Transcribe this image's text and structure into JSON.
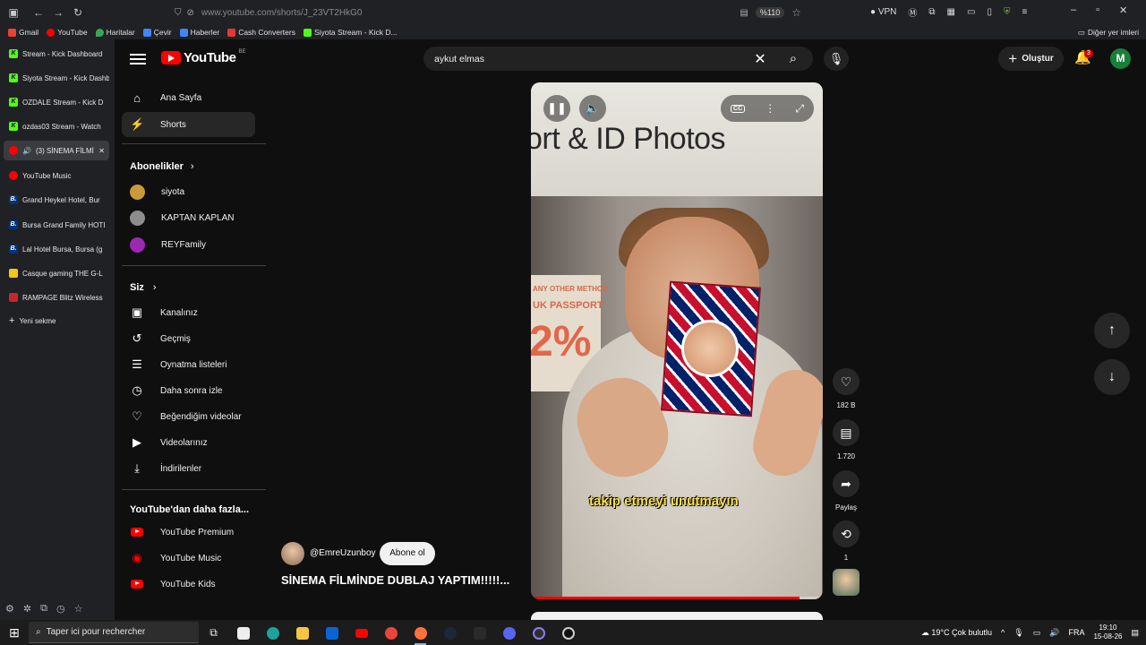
{
  "browser": {
    "url": "www.youtube.com/shorts/J_23VT2HkG0",
    "zoom": "%110",
    "vpn_label": "VPN",
    "bookmarks": [
      {
        "label": "Gmail",
        "color": "#ea4335"
      },
      {
        "label": "YouTube",
        "color": "#ff0000"
      },
      {
        "label": "Haritalar",
        "color": "#34a853"
      },
      {
        "label": "Çevir",
        "color": "#4285f4"
      },
      {
        "label": "Haberler",
        "color": "#4285f4"
      },
      {
        "label": "Cash Converters",
        "color": "#e53935"
      },
      {
        "label": "Siyota Stream - Kick D...",
        "color": "#53fc18"
      }
    ],
    "other_bookmarks": "Diğer yer imleri",
    "tabs": [
      {
        "label": "Stream - Kick Dashboard",
        "fav": "K",
        "color": "#53fc18",
        "active": false
      },
      {
        "label": "Siyota Stream - Kick Dashb",
        "fav": "K",
        "color": "#53fc18",
        "active": false
      },
      {
        "label": "OZDALE Stream - Kick D",
        "fav": "K",
        "color": "#53fc18",
        "active": false
      },
      {
        "label": "ozdas03 Stream - Watch",
        "fav": "K",
        "color": "#53fc18",
        "active": false
      },
      {
        "label": "(3) SİNEMA FİLMİ",
        "fav": "",
        "color": "#ff0000",
        "active": true
      },
      {
        "label": "YouTube Music",
        "fav": "",
        "color": "#ff0000",
        "active": false
      },
      {
        "label": "Grand Heykel Hotel, Bur",
        "fav": "B.",
        "color": "#003580",
        "active": false
      },
      {
        "label": "Bursa Grand Family HOTI",
        "fav": "B.",
        "color": "#003580",
        "active": false
      },
      {
        "label": "Lal Hotel Bursa, Bursa (g",
        "fav": "B.",
        "color": "#003580",
        "active": false
      },
      {
        "label": "Casque gaming THE G-L",
        "fav": "",
        "color": "#f5c518",
        "active": false
      },
      {
        "label": "RAMPAGE Blitz Wireless",
        "fav": "",
        "color": "#c62828",
        "active": false
      }
    ],
    "new_tab": "Yeni sekme"
  },
  "youtube": {
    "logo_text": "YouTube",
    "country": "BE",
    "search_value": "aykut elmas",
    "create_label": "Oluştur",
    "notif_count": "3",
    "avatar_letter": "M",
    "nav": {
      "home": "Ana Sayfa",
      "shorts": "Shorts",
      "subscriptions": "Abonelikler",
      "subs": [
        {
          "label": "siyota",
          "color": "#c99a3a"
        },
        {
          "label": "KAPTAN KAPLAN",
          "color": "#8d8d8d"
        },
        {
          "label": "REYFamily",
          "color": "#9c27b0"
        }
      ],
      "you": "Siz",
      "you_items": [
        {
          "label": "Kanalınız",
          "icon": "channel-icon",
          "glyph": "▣"
        },
        {
          "label": "Geçmiş",
          "icon": "history-icon",
          "glyph": "↺"
        },
        {
          "label": "Oynatma listeleri",
          "icon": "playlists-icon",
          "glyph": "☰"
        },
        {
          "label": "Daha sonra izle",
          "icon": "watch-later-icon",
          "glyph": "◷"
        },
        {
          "label": "Beğendiğim videolar",
          "icon": "liked-icon",
          "glyph": "👍"
        },
        {
          "label": "Videolarınız",
          "icon": "your-videos-icon",
          "glyph": "▶"
        },
        {
          "label": "İndirilenler",
          "icon": "downloads-icon",
          "glyph": "⤓"
        }
      ],
      "more_title": "YouTube'dan daha fazla...",
      "more": [
        "YouTube Premium",
        "YouTube Music",
        "YouTube Kids"
      ]
    },
    "short": {
      "sign_text": "ort & ID Photos",
      "poster_a": "ANY OTHER METHOD",
      "poster_b": "UK PASSPORT",
      "poster_c": "2%",
      "caption": "takip etmeyi unutmayın",
      "progress": 0.92,
      "channel": "@EmreUzunboy",
      "subscribe": "Abone ol",
      "title": "SİNEMA FİLMİNDE DUBLAJ YAPTIM!!!!!...",
      "likes": "182 B",
      "comments": "1.720",
      "share": "Paylaş",
      "remix": "1"
    }
  },
  "taskbar": {
    "search_placeholder": "Taper ici pour rechercher",
    "weather": "19°C  Çok bulutlu",
    "lang": "FRA",
    "time": "19:10",
    "date": "15-08-26"
  }
}
